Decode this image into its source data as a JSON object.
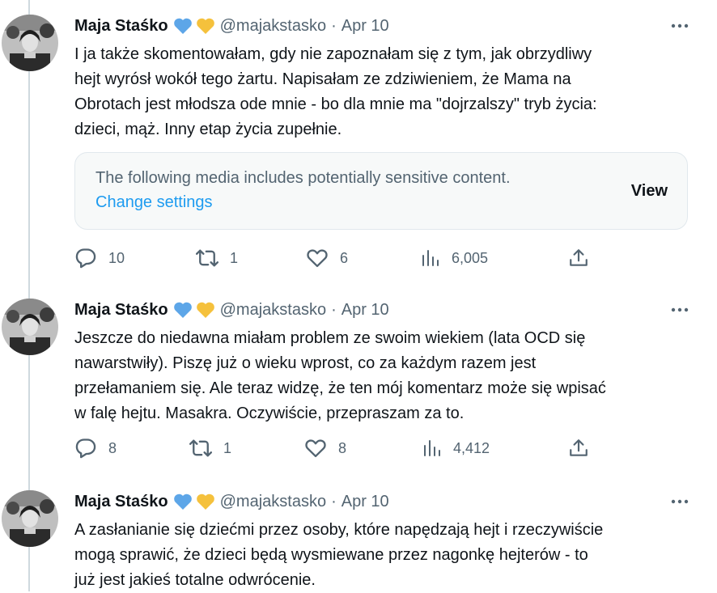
{
  "tweets": [
    {
      "name": "Maja Staśko",
      "handle": "@majakstasko",
      "separator": "·",
      "date": "Apr 10",
      "lines": [
        "I ja także skomentowałam, gdy nie zapoznałam się z tym, jak obrzydliwy",
        "hejt wyrósł wokół tego żartu. Napisałam ze zdziwieniem, że Mama na",
        "Obrotach jest młodsza ode mnie - bo dla mnie ma \"dojrzalszy\" tryb życia:",
        "dzieci, mąż. Inny etap życia zupełnie."
      ],
      "sensitive": {
        "message": "The following media includes potentially sensitive content.",
        "link": "Change settings",
        "button": "View"
      },
      "stats": {
        "replies": "10",
        "reposts": "1",
        "likes": "6",
        "views": "6,005"
      }
    },
    {
      "name": "Maja Staśko",
      "handle": "@majakstasko",
      "separator": "·",
      "date": "Apr 10",
      "lines": [
        "Jeszcze do niedawna miałam problem ze swoim wiekiem (lata OCD się",
        "nawarstwiły). Piszę już o wieku wprost, co za każdym razem jest",
        "przełamaniem się. Ale teraz widzę, że ten mój komentarz może się wpisać",
        "w falę hejtu. Masakra. Oczywiście, przepraszam za to."
      ],
      "stats": {
        "replies": "8",
        "reposts": "1",
        "likes": "8",
        "views": "4,412"
      }
    },
    {
      "name": "Maja Staśko",
      "handle": "@majakstasko",
      "separator": "·",
      "date": "Apr 10",
      "lines": [
        "A zasłanianie się dziećmi przez osoby, które napędzają hejt i rzeczywiście",
        "mogą sprawić, że dzieci będą wysmiewane przez nagonkę hejterów - to",
        "już jest jakieś totalne odwrócenie."
      ]
    }
  ],
  "colors": {
    "text": "#0f1419",
    "secondary": "#536471",
    "link": "#1d9bf0",
    "heart_blue": "#5da6e8",
    "heart_yellow": "#f5c13c",
    "thread_line": "#cfd9de"
  },
  "icons": {
    "reply": "speech-bubble-icon",
    "repost": "repost-arrows-icon",
    "like": "heart-outline-icon",
    "views": "bar-chart-icon",
    "share": "share-upload-icon",
    "more": "ellipsis-icon"
  }
}
